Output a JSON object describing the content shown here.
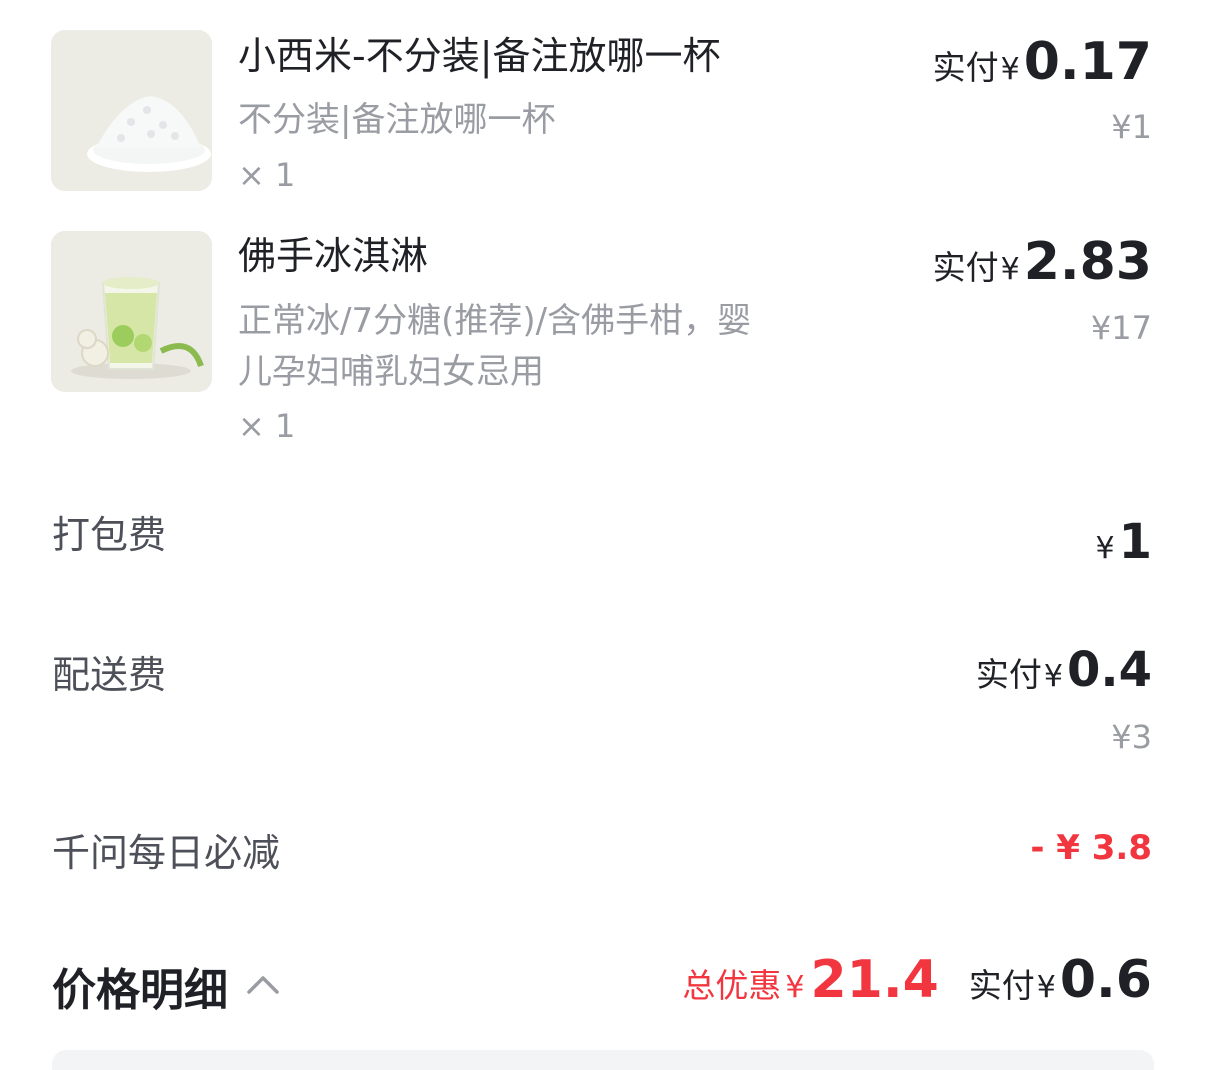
{
  "items": [
    {
      "name": "小西米-不分装|备注放哪一杯",
      "spec": "不分装|备注放哪一杯",
      "qty": "× 1",
      "paid_label": "实付",
      "currency": "¥",
      "paid_amount": "0.17",
      "original_price": "¥1",
      "image": "sago-pearls-image"
    },
    {
      "name": "佛手冰淇淋",
      "spec_line1": "正常冰/7分糖(推荐)/含佛手柑，婴",
      "spec_line2": "儿孕妇哺乳妇女忌用",
      "qty": "× 1",
      "paid_label": "实付",
      "currency": "¥",
      "paid_amount": "2.83",
      "original_price": "¥17",
      "image": "bergamot-ice-cream-image"
    }
  ],
  "fees": {
    "packing": {
      "label": "打包费",
      "currency": "¥",
      "amount": "1"
    },
    "delivery": {
      "label": "配送费",
      "paid_label": "实付",
      "currency": "¥",
      "amount": "0.4",
      "original_price": "¥3"
    },
    "discount": {
      "label": "千问每日必减",
      "value": "- ¥ 3.8"
    }
  },
  "summary": {
    "title": "价格明细",
    "total_discount_label": "总优惠",
    "currency": "¥",
    "total_discount_amount": "21.4",
    "paid_label": "实付",
    "paid_amount": "0.6"
  },
  "colors": {
    "accent_red": "#f2363f",
    "text_primary": "#1f2126",
    "text_secondary": "#9a9ca3"
  }
}
